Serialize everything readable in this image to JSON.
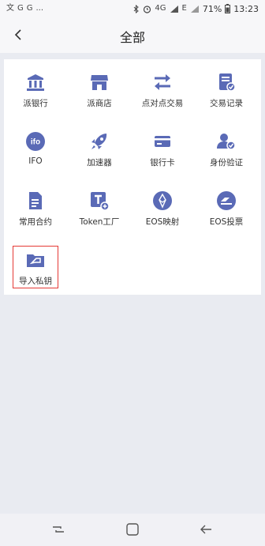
{
  "status_bar": {
    "app_icons": [
      "文",
      "G",
      "G"
    ],
    "more": "...",
    "network_labels": [
      "4G",
      "E"
    ],
    "battery": "71%",
    "time": "13:23"
  },
  "header": {
    "title": "全部"
  },
  "colors": {
    "icon_accent": "#5a6ab6",
    "highlight": "#e53935",
    "background": "#e9ebf1"
  },
  "grid": [
    {
      "label": "派银行",
      "icon": "bank-icon"
    },
    {
      "label": "派商店",
      "icon": "store-icon"
    },
    {
      "label": "点对点交易",
      "icon": "transfer-icon"
    },
    {
      "label": "交易记录",
      "icon": "record-icon"
    },
    {
      "label": "IFO",
      "icon": "ifo-icon",
      "icon_text": "ifo"
    },
    {
      "label": "加速器",
      "icon": "rocket-icon"
    },
    {
      "label": "银行卡",
      "icon": "card-icon"
    },
    {
      "label": "身份验证",
      "icon": "identity-icon"
    },
    {
      "label": "常用合约",
      "icon": "contract-icon"
    },
    {
      "label": "Token工厂",
      "icon": "token-factory-icon"
    },
    {
      "label": "EOS映射",
      "icon": "eos-icon"
    },
    {
      "label": "EOS投票",
      "icon": "vote-icon"
    },
    {
      "label": "导入私钥",
      "icon": "import-key-icon"
    }
  ]
}
